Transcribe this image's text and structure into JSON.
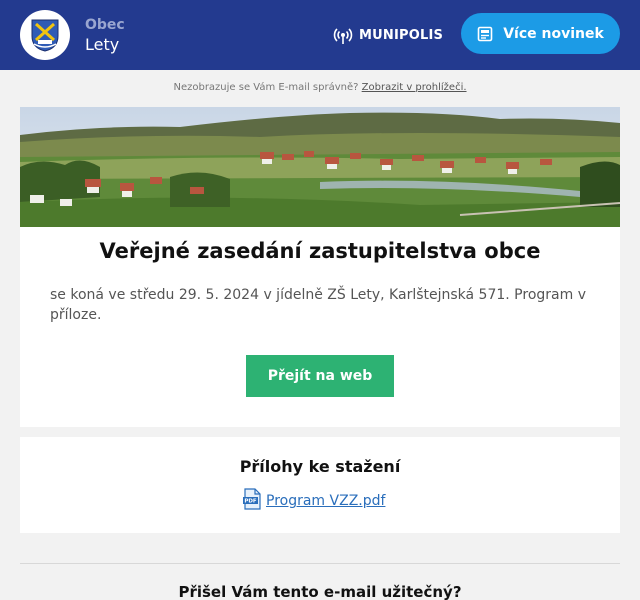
{
  "header": {
    "org_label": "Obec",
    "org_name": "Lety",
    "brand": "MUNIPOLIS",
    "news_button": "Více novinek",
    "colors": {
      "bar": "#233a8f",
      "button": "#1c9be6"
    }
  },
  "notice": {
    "text": "Nezobrazuje se Vám E-mail správně?",
    "link": "Zobrazit v prohlížeči."
  },
  "article": {
    "title": "Veřejné zasedání zastupitelstva obce",
    "body": "se koná ve středu 29. 5. 2024 v jídelně ZŠ Lety, Karlštejnská 571. Program v příloze.",
    "button": "Přejít na web",
    "button_color": "#2db273"
  },
  "attachments": {
    "title": "Přílohy ke stažení",
    "items": [
      {
        "icon": "pdf-file-icon",
        "label": "Program VZZ.pdf"
      }
    ]
  },
  "footer": {
    "question": "Přišel Vám tento e-mail užitečný?"
  }
}
